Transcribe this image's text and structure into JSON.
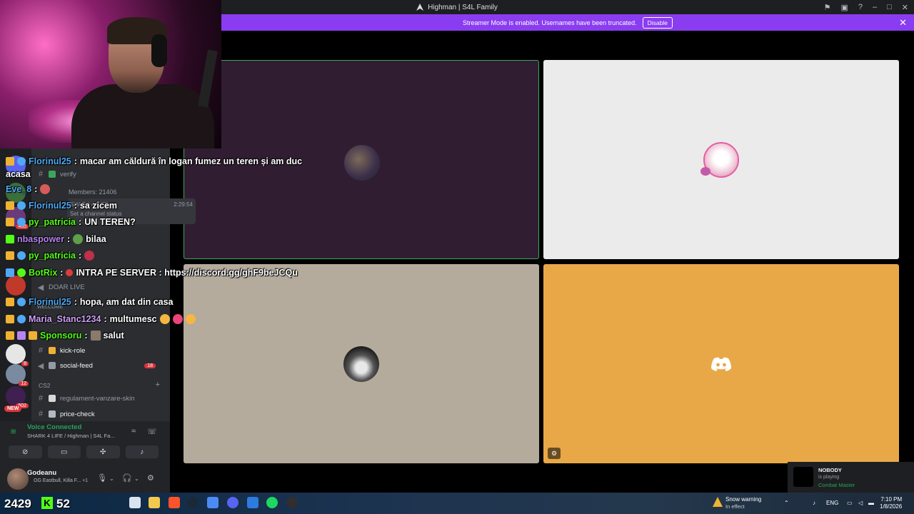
{
  "window": {
    "title": "Highman | S4L Family"
  },
  "banner": {
    "text": "Streamer Mode is enabled. Usernames have been truncated.",
    "button": "Disable",
    "close": "✕"
  },
  "sidebar": {
    "members": "Members: 21406",
    "sticky_title": "SHARK 4 LIFE",
    "sticky_time": "2:29:54",
    "sticky_sub": "Set a channel status",
    "channels": [
      {
        "label": "verify"
      },
      {
        "label": "DOAR LIVE"
      },
      {
        "label": "WELCOME"
      },
      {
        "label": "kick-role"
      },
      {
        "label": "social-feed",
        "badge": "18"
      },
      {
        "label": "regulament-vanzare-skin"
      },
      {
        "label": "price-check"
      }
    ],
    "category": "CS2",
    "server_badges": [
      "465",
      "8",
      "12",
      "502"
    ],
    "new_badge": "NEW"
  },
  "voice": {
    "status": "Voice Connected",
    "channel": "SHARK 4 LIFE / Highman | S4L Fa..."
  },
  "user": {
    "name": "Godeanu",
    "status": "OG Eastbull, Killa F... +1"
  },
  "chat": [
    {
      "user": "Florinul25",
      "text": "macar am căldură în logan fumez un teren și am duc",
      "color": "#4fa9f5"
    },
    {
      "user": "",
      "text": "acasa",
      "color": "#fff"
    },
    {
      "user": "Eve_8",
      "text": "",
      "color": "#4fa9f5"
    },
    {
      "user": "Florinul25",
      "text": "sa zicem",
      "color": "#4fa9f5"
    },
    {
      "user": "py_patricia",
      "text": "UN TEREN?",
      "color": "#53fc18"
    },
    {
      "user": "nbaspower",
      "text": "bilaa",
      "color": "#b784f0"
    },
    {
      "user": "py_patricia",
      "text": "",
      "color": "#53fc18"
    },
    {
      "user": "BotRix",
      "text": "INTRA PE SERVER : https://discord.gg/ghF9beJCQu",
      "color": "#53fc18"
    },
    {
      "user": "Florinul25",
      "text": "hopa, am dat din casa",
      "color": "#4fa9f5"
    },
    {
      "user": "Maria_Stanc1234",
      "text": "multumesc",
      "color": "#cfa0f7"
    },
    {
      "user": "Sponsoru",
      "text": "salut",
      "color": "#53fc18"
    }
  ],
  "now_playing": {
    "name": "NOBODY",
    "doing": "is playing",
    "game": "Combat Master"
  },
  "taskbar": {
    "followers": "2429",
    "viewers": "52",
    "kick_letter": "K",
    "weather_title": "Snow warning",
    "weather_sub": "In effect",
    "lang": "ENG",
    "time": "7:10 PM",
    "date": "1/8/2026"
  },
  "colors": {
    "accent": "#8a3df0",
    "voice_green": "#23a55a",
    "kick_green": "#53fc18",
    "tile_active_border": "#3ba55d"
  }
}
